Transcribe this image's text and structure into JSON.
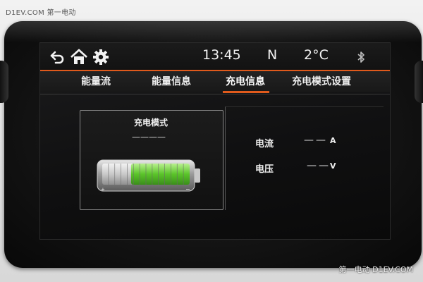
{
  "watermark": {
    "top": "D1EV.COM 第一电动",
    "bottom": "第一电动 D1EV.COM"
  },
  "statusbar": {
    "time": "13:45",
    "gear": "N",
    "temperature": "2°C",
    "icons": [
      "back-icon",
      "home-icon",
      "settings-icon",
      "bluetooth-icon"
    ]
  },
  "tabs": [
    {
      "label": "能量流",
      "active": false
    },
    {
      "label": "能量信息",
      "active": false
    },
    {
      "label": "充电信息",
      "active": true
    },
    {
      "label": "充电模式设置",
      "active": false
    }
  ],
  "charge_panel": {
    "mode_label": "充电模式",
    "mode_value": "————",
    "battery_level": 0.67
  },
  "info": {
    "current_label": "电流",
    "current_value": "——",
    "current_unit": "A",
    "voltage_label": "电压",
    "voltage_value": "——",
    "voltage_unit": "V"
  },
  "colors": {
    "accent": "#e05a1c",
    "battery_fill": "#6fd23a"
  }
}
